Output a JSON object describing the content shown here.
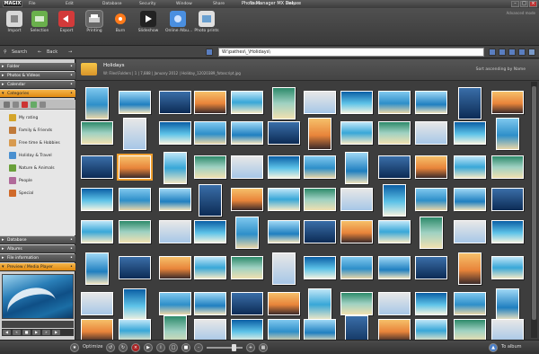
{
  "app": {
    "logo": "MAGIX",
    "title": "Photo Manager MX Deluxe",
    "menu": [
      "File",
      "Edit",
      "Database",
      "Security",
      "Window",
      "Share",
      "Tasks",
      "Help"
    ],
    "advanced": "Advanced mode"
  },
  "toolbar": {
    "buttons": [
      {
        "label": "Import",
        "icon": "import-icon",
        "color": "#d8d8d8"
      },
      {
        "label": "Selection",
        "icon": "selection-icon",
        "color": "#6ab04c"
      },
      {
        "label": "Export",
        "icon": "export-icon",
        "color": "#d23a3a"
      },
      {
        "label": "Printing",
        "icon": "printer-icon",
        "color": "#cfcfcf"
      },
      {
        "label": "Burn",
        "icon": "burn-disc-icon",
        "color": "#ff7a1a"
      },
      {
        "label": "Slideshow",
        "icon": "slideshow-icon",
        "color": "#444"
      },
      {
        "label": "Online Albu...",
        "icon": "online-album-icon",
        "color": "#4a8fe0"
      },
      {
        "label": "Photo prints",
        "icon": "photo-prints-icon",
        "color": "#e0e0e0"
      }
    ]
  },
  "searchbar": {
    "search_label": "Search",
    "back_label": "Back",
    "path": "W:\\pathes\\_\\Holidays\\"
  },
  "sidebar": {
    "sections_top": [
      "Folder",
      "Photos & Videos",
      "Calendar",
      "Categories"
    ],
    "categories": [
      {
        "label": "My rating",
        "color": "#d4a52a"
      },
      {
        "label": "Family & Friends",
        "color": "#c07a3a"
      },
      {
        "label": "Free time & Hobbies",
        "color": "#d89b50"
      },
      {
        "label": "Holiday & Travel",
        "color": "#4a90d0"
      },
      {
        "label": "Nature & Animals",
        "color": "#6aa03a"
      },
      {
        "label": "People",
        "color": "#b06a9a"
      },
      {
        "label": "Special",
        "color": "#d06a2a"
      }
    ],
    "sections_bottom": [
      "Database",
      "Albums",
      "File information",
      "Preview / Media Player"
    ]
  },
  "main": {
    "folder_title": "Holidays",
    "folder_path": "W: Files\\Folders | 1 | 7,888 | January 2012 | Holiday_12020389_fotoscript.jpg",
    "sort_label": "Sort ascending by Name"
  },
  "bottombar": {
    "optimize_label": "Optimize",
    "to_album_label": "To album"
  },
  "colors": {
    "accent": "#f0a030",
    "toolbar_bg": "#454545"
  }
}
